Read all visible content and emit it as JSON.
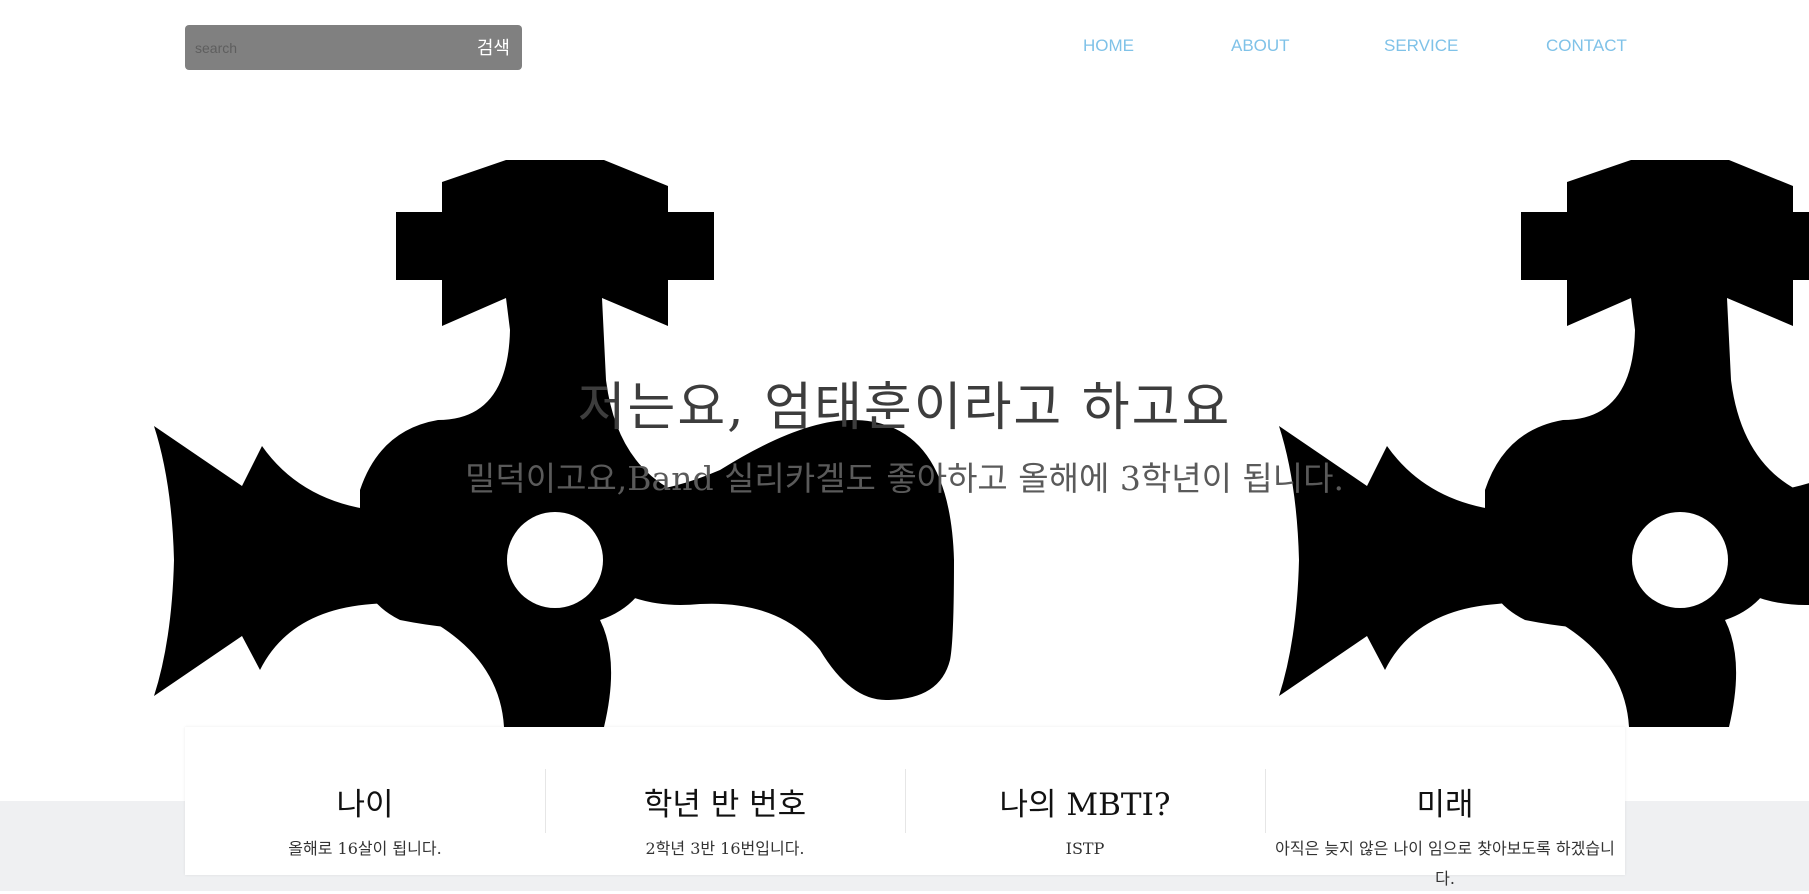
{
  "search": {
    "placeholder": "search",
    "button_label": "검색"
  },
  "nav": {
    "items": [
      "HOME",
      "ABOUT",
      "SERVICE",
      "CONTACT"
    ],
    "color": "#7fc2e8"
  },
  "hero": {
    "title": "저는요, 엄태훈이라고 하고요",
    "subtitle": "밀덕이고요,Band 실리카겔도 좋아하고 올해에 3학년이 됩니다."
  },
  "cards": [
    {
      "title": "나이",
      "text": "올해로 16살이 됩니다."
    },
    {
      "title": "학년 반 번호",
      "text": "2학년 3반 16번입니다."
    },
    {
      "title": "나의 MBTI?",
      "text": "ISTP"
    },
    {
      "title": "미래",
      "text": "아직은 늦지 않은 나이 임으로 찾아보도록 하겠습니다."
    }
  ],
  "icons": [
    "shuriken-icon"
  ]
}
